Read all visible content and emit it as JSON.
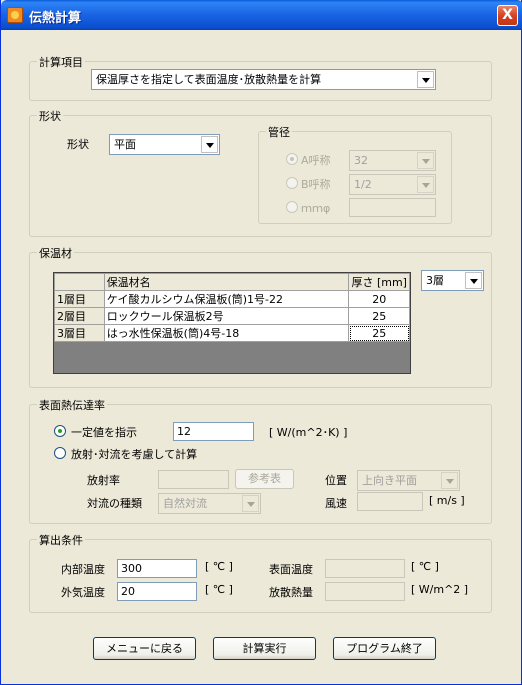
{
  "window": {
    "title": "伝熱計算",
    "close_label": "X"
  },
  "calc_item": {
    "group_title": "計算項目",
    "selected": "保温厚さを指定して表面温度･放散熱量を計算"
  },
  "shape": {
    "group_title": "形状",
    "label": "形状",
    "selected": "平面",
    "pipe": {
      "group_title": "管径",
      "a_label": "A呼称",
      "a_value": "32",
      "b_label": "B呼称",
      "b_value": "1/2",
      "mm_label": "ｍｍφ",
      "mm_value": ""
    }
  },
  "insulation": {
    "group_title": "保温材",
    "layers_selected": "3層",
    "columns": [
      "",
      "保温材名",
      "厚さ [mm]"
    ],
    "rows": [
      {
        "layer": "1層目",
        "name": "ケイ酸カルシウム保温板(筒)1号-22",
        "thickness": "20"
      },
      {
        "layer": "2層目",
        "name": "ロックウール保温板2号",
        "thickness": "25"
      },
      {
        "layer": "3層目",
        "name": "はっ水性保温板(筒)4号-18",
        "thickness": "25"
      }
    ]
  },
  "surface_htc": {
    "group_title": "表面熱伝達率",
    "fixed_label": "一定値を指示",
    "fixed_value": "12",
    "fixed_unit": "[ W/(m^2･K) ]",
    "calc_label": "放射･対流を考慮して計算",
    "emissivity_label": "放射率",
    "emissivity_value": "",
    "ref_button": "参考表",
    "position_label": "位置",
    "position_value": "上向き平面",
    "convection_label": "対流の種類",
    "convection_value": "自然対流",
    "wind_label": "風速",
    "wind_value": "",
    "wind_unit": "[ m/s ]"
  },
  "conditions": {
    "group_title": "算出条件",
    "inner_temp_label": "内部温度",
    "inner_temp_value": "300",
    "inner_temp_unit": "[ ℃ ]",
    "outer_temp_label": "外気温度",
    "outer_temp_value": "20",
    "outer_temp_unit": "[ ℃ ]",
    "surface_temp_label": "表面温度",
    "surface_temp_value": "",
    "surface_temp_unit": "[ ℃ ]",
    "heat_loss_label": "放散熱量",
    "heat_loss_value": "",
    "heat_loss_unit": "[ W/m^2 ]"
  },
  "buttons": {
    "menu": "メニューに戻る",
    "run": "計算実行",
    "exit": "プログラム終了"
  }
}
